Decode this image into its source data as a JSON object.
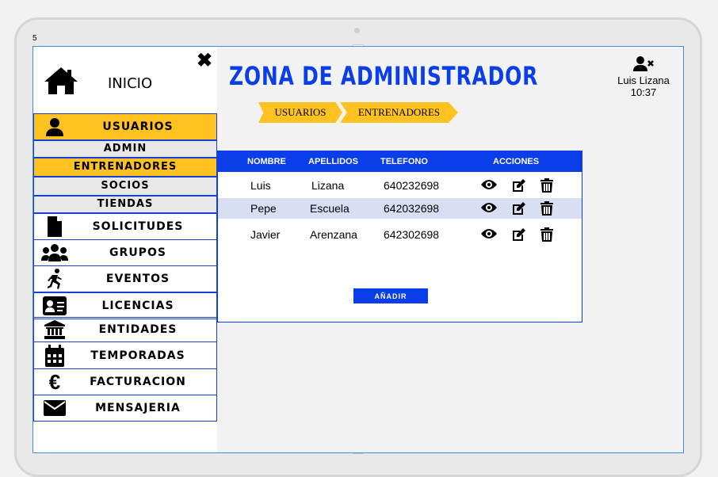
{
  "page_number": "5",
  "sidebar": {
    "home_label": "INICIO",
    "items": [
      {
        "label": "USUARIOS",
        "icon": "user-icon"
      },
      {
        "label": "SOLICITUDES",
        "icon": "file-icon"
      },
      {
        "label": "GRUPOS",
        "icon": "users-icon"
      },
      {
        "label": "EVENTOS",
        "icon": "running-icon"
      },
      {
        "label": "LICENCIAS",
        "icon": "id-card-icon"
      },
      {
        "label": "ENTIDADES",
        "icon": "bank-icon"
      },
      {
        "label": "TEMPORADAS",
        "icon": "calendar-icon"
      },
      {
        "label": "FACTURACION",
        "icon": "euro-icon"
      },
      {
        "label": "MENSAJERIA",
        "icon": "envelope-icon"
      }
    ],
    "sub_items": [
      "ADMIN",
      "ENTRENADORES",
      "SOCIOS",
      "TIENDAS"
    ]
  },
  "header": {
    "title": "ZONA DE ADMINISTRADOR",
    "user_name": "Luis Lizana",
    "time": "10:37"
  },
  "tabs": [
    "USUARIOS",
    "ENTRENADORES"
  ],
  "table": {
    "columns": [
      "NOMBRE",
      "APELLIDOS",
      "TELEFONO",
      "ACCIONES"
    ],
    "rows": [
      {
        "nombre": "Luis",
        "apellidos": "Lizana",
        "telefono": "640232698"
      },
      {
        "nombre": "Pepe",
        "apellidos": "Escuela",
        "telefono": "642032698"
      },
      {
        "nombre": "Javier",
        "apellidos": "Arenzana",
        "telefono": "642302698"
      }
    ],
    "add_label": "AÑADIR"
  },
  "colors": {
    "accent": "#0a3ee8",
    "highlight": "#ffc220",
    "row_alt": "#d8dff5"
  }
}
